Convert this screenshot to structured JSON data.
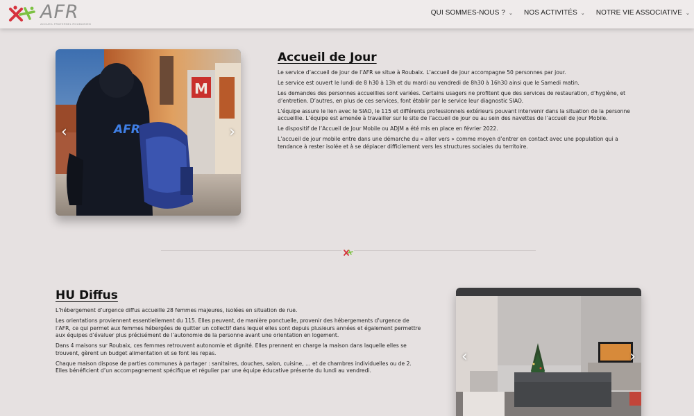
{
  "header": {
    "logo_text": "AFR",
    "logo_tagline": "ACCUEIL FRATERNEL ROUBAISIEN",
    "nav": [
      {
        "label": "QUI SOMMES-NOUS ?"
      },
      {
        "label": "NOS ACTIVITÉS"
      },
      {
        "label": "NOTRE VIE ASSOCIATIVE"
      }
    ]
  },
  "section1": {
    "title": "Accueil de Jour",
    "paragraphs": [
      "Le service d’accueil de jour de l’AFR se situe à Roubaix. L’accueil de jour accompagne 50 personnes par jour.",
      "Le service est ouvert le lundi de 8 h30 à 13h et du mardi au vendredi de 8h30 à 16h30 ainsi que le Samedi matin.",
      "Les demandes des personnes accueillies sont variées. Certains usagers ne profitent que des services de restauration, d’hygiène, et d’entretien. D’autres, en plus de ces services, font établir par le service leur diagnostic SIAO.",
      "L’équipe assure le lien avec le SIAO, le 115 et différents professionnels extérieurs pouvant intervenir dans la situation de la personne accueillie. L’équipe est amenée à travailler sur le site de l’accueil de jour ou au sein des navettes de l’accueil de jour Mobile.",
      "Le dispositif de l’Accueil de Jour Mobile ou ADJM a été mis en place en février 2022.",
      "L’accueil de jour mobile entre dans une démarche du « aller vers » comme moyen d’entrer en contact avec une population qui a tendance à rester isolée et à se déplacer difficilement vers les structures sociales du territoire."
    ],
    "photo_jacket_text": "AFR"
  },
  "section2": {
    "title": "HU Diffus",
    "paragraphs": [
      "L’hébergement d’urgence diffus accueille 28 femmes majeures, isolées en situation de rue.",
      "Les orientations proviennent essentiellement du 115. Elles peuvent, de manière ponctuelle, provenir des hébergements d’urgence de l’AFR, ce qui permet aux femmes hébergées de quitter un collectif dans lequel elles sont depuis plusieurs années et également permettre aux équipes d’évaluer plus précisément de l’autonomie de la personne avant une orientation en logement.",
      "Dans 4 maisons sur Roubaix, ces femmes retrouvent autonomie et dignité. Elles prennent en charge la maison dans laquelle elles se trouvent, gèrent un budget alimentation et se font les repas.",
      "Chaque maison dispose de parties communes à partager : sanitaires, douches, salon, cuisine, … et de chambres individuelles ou de 2. Elles bénéficient d’un accompagnement spécifique et régulier par une équipe éducative présente du lundi au vendredi."
    ]
  },
  "carousel": {
    "prev": "‹",
    "next": "›"
  },
  "colors": {
    "brand_red": "#d6323c",
    "brand_green": "#7cc142",
    "logo_gray": "#8a8a8a",
    "page_bg": "#e6e1e1"
  }
}
